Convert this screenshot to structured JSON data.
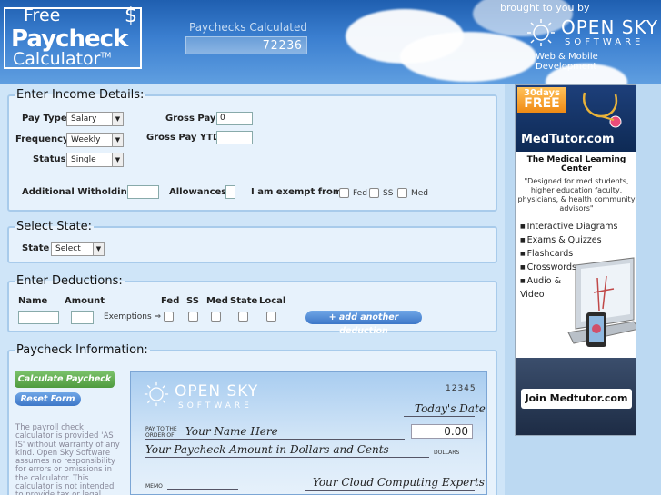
{
  "header": {
    "logo_free": "Free",
    "logo_paycheck": "Paycheck",
    "logo_calculator": "Calculator",
    "logo_tm": "TM",
    "logo_dollar": "$",
    "counter_label": "Paychecks Calculated",
    "counter_value": "72236",
    "brought_by": "brought to you by",
    "company_name": "OPEN SKY",
    "company_sub": "SOFTWARE",
    "tagline": "Web & Mobile Development"
  },
  "income": {
    "legend": "Enter Income Details:",
    "pay_type_label": "Pay Type",
    "pay_type_value": "Salary",
    "frequency_label": "Frequency",
    "frequency_value": "Weekly",
    "status_label": "Status",
    "status_value": "Single",
    "gross_pay_label": "Gross Pay",
    "gross_pay_value": "0",
    "gross_ytd_label": "Gross Pay YTD",
    "gross_ytd_value": "",
    "withholding_label": "Additional Witholding",
    "allowances_label": "Allowances",
    "exempt_label": "I am exempt from:",
    "exempt_fed": "Fed",
    "exempt_ss": "SS",
    "exempt_med": "Med"
  },
  "state": {
    "legend": "Select State:",
    "label": "State",
    "value": "Select"
  },
  "deductions": {
    "legend": "Enter Deductions:",
    "name_col": "Name",
    "amount_col": "Amount",
    "fed_col": "Fed",
    "ss_col": "SS",
    "med_col": "Med",
    "state_col": "State",
    "local_col": "Local",
    "exemptions_label": "Exemptions ⇒",
    "add_button": "+ add another deduction"
  },
  "paycheck": {
    "legend": "Paycheck Information:",
    "calculate_button": "Calculate Paycheck",
    "reset_button": "Reset Form",
    "disclaimer": "The payroll check calculator is provided 'AS IS' without warranty of any kind. Open Sky Software assumes no responsibility for errors or omissions in the calculator. This calculator is not intended to provide tax or legal advice - please refer to your professional",
    "check": {
      "company_name": "OPEN SKY",
      "company_sub": "SOFTWARE",
      "number": "12345",
      "date": "Today's Date",
      "pay_to_label": "PAY TO THE ORDER OF",
      "payee": "Your Name Here",
      "amount": "0.00",
      "amount_words": "Your Paycheck Amount in Dollars and Cents",
      "dollars_label": "DOLLARS",
      "memo_label": "MEMO",
      "signature": "Your Cloud Computing Experts"
    }
  },
  "ad": {
    "badge_days": "30days",
    "badge_free": "FREE",
    "brand": "MedTutor.com",
    "center_title": "The Medical Learning Center",
    "quote": "\"Designed for med students, higher education faculty, physicians, & health community advisors\"",
    "features": [
      "Interactive Diagrams",
      "Exams & Quizzes",
      "Flashcards",
      "Crosswords",
      "Audio & Video"
    ],
    "join_button": "Join Medtutor.com"
  },
  "colors": {
    "header_blue": "#3b7fd0",
    "panel_bg": "#cfe5f8",
    "fieldset_border": "#a8cbeb",
    "calc_green": "#4e9a3e",
    "button_blue": "#3d77c8"
  }
}
